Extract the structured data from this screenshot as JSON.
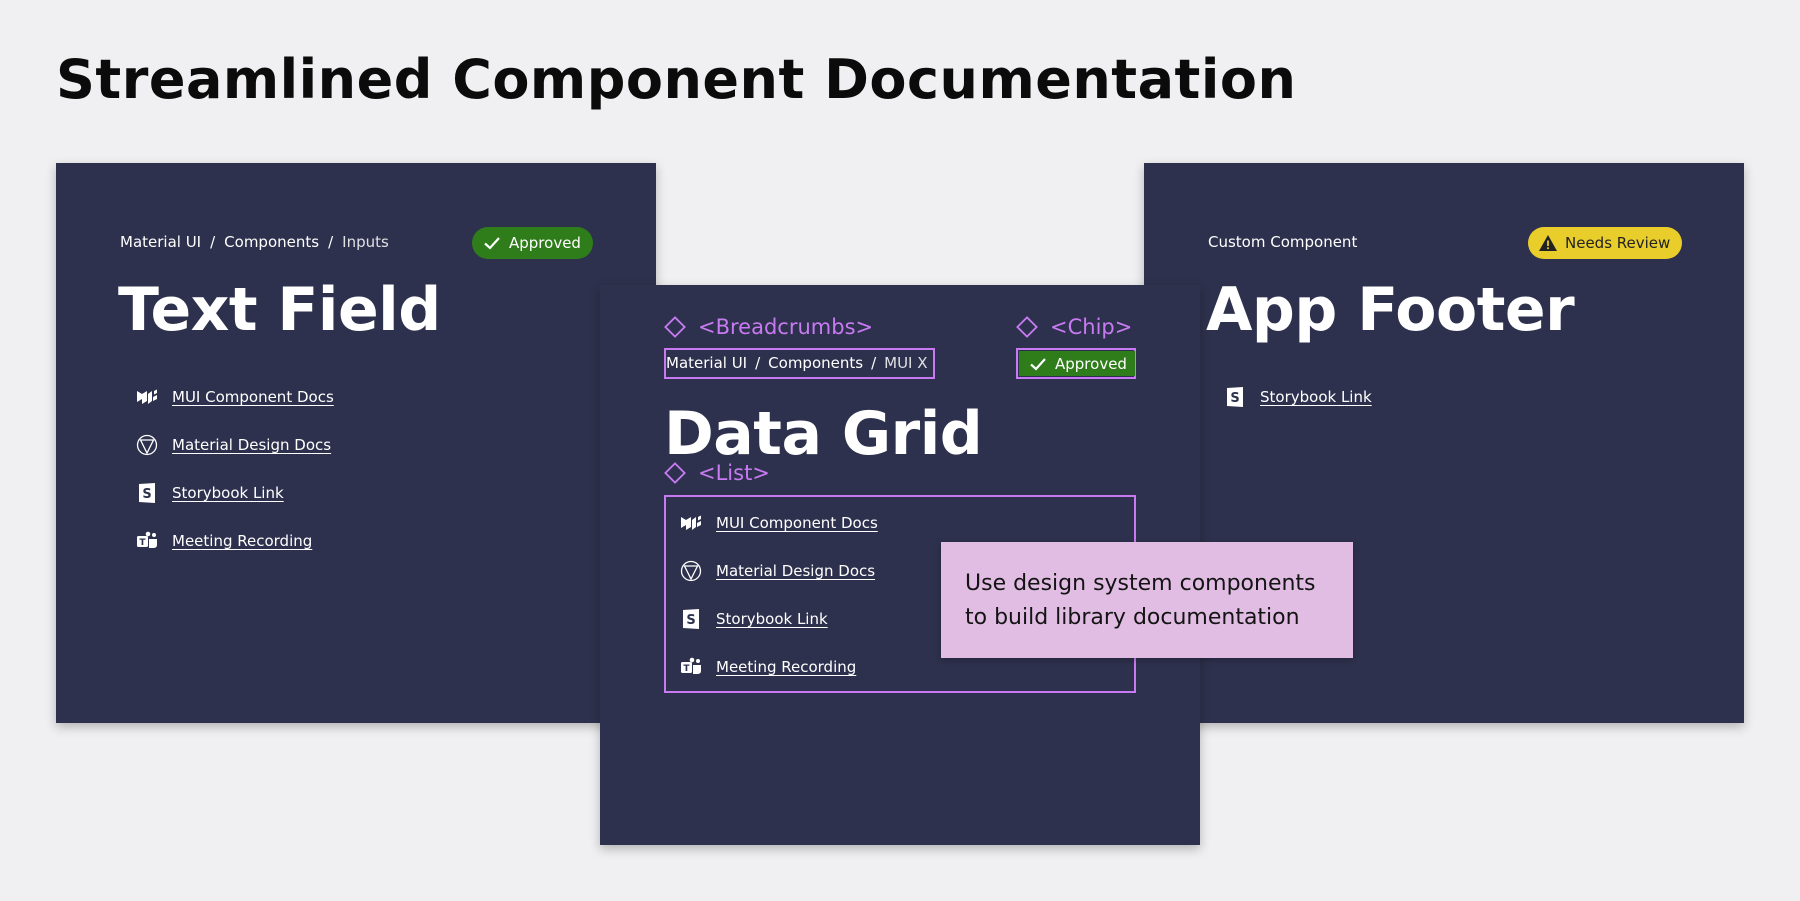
{
  "page": {
    "title": "Streamlined Component Documentation"
  },
  "cards": {
    "left": {
      "breadcrumbs": [
        "Material UI",
        "Components",
        "Inputs"
      ],
      "chip": "Approved",
      "title": "Text Field",
      "links": [
        {
          "label": "MUI Component Docs",
          "icon": "mui-icon"
        },
        {
          "label": "Material Design Docs",
          "icon": "material-design-icon"
        },
        {
          "label": "Storybook Link",
          "icon": "storybook-icon"
        },
        {
          "label": "Meeting Recording",
          "icon": "teams-icon"
        }
      ]
    },
    "middle": {
      "annotations": {
        "breadcrumbs": "<Breadcrumbs>",
        "chip": "<Chip>",
        "list": "<List>"
      },
      "breadcrumbs": [
        "Material UI",
        "Components",
        "MUI X"
      ],
      "chip": "Approved",
      "title": "Data Grid",
      "links": [
        {
          "label": "MUI Component Docs",
          "icon": "mui-icon"
        },
        {
          "label": "Material Design Docs",
          "icon": "material-design-icon"
        },
        {
          "label": "Storybook Link",
          "icon": "storybook-icon"
        },
        {
          "label": "Meeting Recording",
          "icon": "teams-icon"
        }
      ]
    },
    "right": {
      "breadcrumb": "Custom Component",
      "chip": "Needs Review",
      "title": "App Footer",
      "links": [
        {
          "label": "Storybook Link",
          "icon": "storybook-icon"
        }
      ]
    }
  },
  "note": {
    "text": "Use design system components to build library documentation"
  },
  "colors": {
    "background": "#f0f0f2",
    "card": "#2e314d",
    "approved": "#2e7d1a",
    "needs_review": "#e9cd2a",
    "annotation": "#c87af2",
    "note": "#e1bde4"
  }
}
